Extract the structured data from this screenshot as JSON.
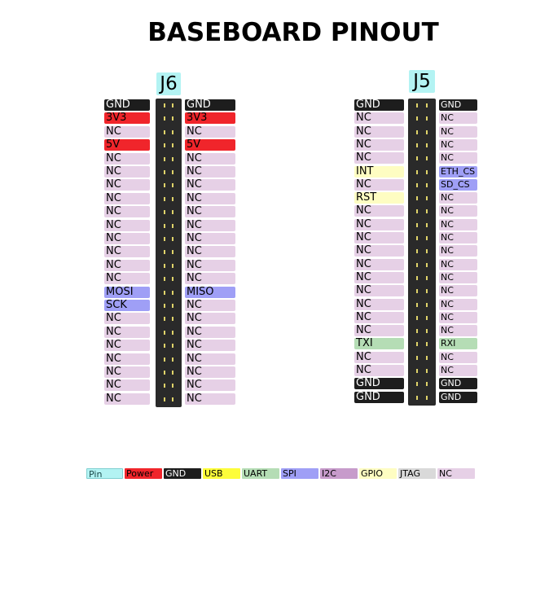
{
  "title": "BASEBOARD PINOUT",
  "colors": {
    "Pin": "#b3f3f3",
    "Power": "#f0252b",
    "GND": "#1d1d1d",
    "USB": "#fdfd3a",
    "UART": "#b5ddb5",
    "SPI": "#9f9ff6",
    "I2C": "#c79bcb",
    "GPIO": "#fefdc2",
    "JTAG": "#d9d9d9",
    "NC": "#e6d0e6"
  },
  "connectors": [
    {
      "name": "J6",
      "left": [
        {
          "label": "GND",
          "type": "GND"
        },
        {
          "label": "3V3",
          "type": "Power"
        },
        {
          "label": "NC",
          "type": "NC"
        },
        {
          "label": "5V",
          "type": "Power"
        },
        {
          "label": "NC",
          "type": "NC"
        },
        {
          "label": "NC",
          "type": "NC"
        },
        {
          "label": "NC",
          "type": "NC"
        },
        {
          "label": "NC",
          "type": "NC"
        },
        {
          "label": "NC",
          "type": "NC"
        },
        {
          "label": "NC",
          "type": "NC"
        },
        {
          "label": "NC",
          "type": "NC"
        },
        {
          "label": "NC",
          "type": "NC"
        },
        {
          "label": "NC",
          "type": "NC"
        },
        {
          "label": "NC",
          "type": "NC"
        },
        {
          "label": "MOSI",
          "type": "SPI"
        },
        {
          "label": "SCK",
          "type": "SPI"
        },
        {
          "label": "NC",
          "type": "NC"
        },
        {
          "label": "NC",
          "type": "NC"
        },
        {
          "label": "NC",
          "type": "NC"
        },
        {
          "label": "NC",
          "type": "NC"
        },
        {
          "label": "NC",
          "type": "NC"
        },
        {
          "label": "NC",
          "type": "NC"
        },
        {
          "label": "NC",
          "type": "NC"
        }
      ],
      "right": [
        {
          "label": "GND",
          "type": "GND"
        },
        {
          "label": "3V3",
          "type": "Power"
        },
        {
          "label": "NC",
          "type": "NC"
        },
        {
          "label": "5V",
          "type": "Power"
        },
        {
          "label": "NC",
          "type": "NC"
        },
        {
          "label": "NC",
          "type": "NC"
        },
        {
          "label": "NC",
          "type": "NC"
        },
        {
          "label": "NC",
          "type": "NC"
        },
        {
          "label": "NC",
          "type": "NC"
        },
        {
          "label": "NC",
          "type": "NC"
        },
        {
          "label": "NC",
          "type": "NC"
        },
        {
          "label": "NC",
          "type": "NC"
        },
        {
          "label": "NC",
          "type": "NC"
        },
        {
          "label": "NC",
          "type": "NC"
        },
        {
          "label": "MISO",
          "type": "SPI"
        },
        {
          "label": "NC",
          "type": "NC"
        },
        {
          "label": "NC",
          "type": "NC"
        },
        {
          "label": "NC",
          "type": "NC"
        },
        {
          "label": "NC",
          "type": "NC"
        },
        {
          "label": "NC",
          "type": "NC"
        },
        {
          "label": "NC",
          "type": "NC"
        },
        {
          "label": "NC",
          "type": "NC"
        },
        {
          "label": "NC",
          "type": "NC"
        }
      ]
    },
    {
      "name": "J5",
      "left": [
        {
          "label": "GND",
          "type": "GND"
        },
        {
          "label": "NC",
          "type": "NC"
        },
        {
          "label": "NC",
          "type": "NC"
        },
        {
          "label": "NC",
          "type": "NC"
        },
        {
          "label": "NC",
          "type": "NC"
        },
        {
          "label": "INT",
          "type": "GPIO"
        },
        {
          "label": "NC",
          "type": "NC"
        },
        {
          "label": "RST",
          "type": "GPIO"
        },
        {
          "label": "NC",
          "type": "NC"
        },
        {
          "label": "NC",
          "type": "NC"
        },
        {
          "label": "NC",
          "type": "NC"
        },
        {
          "label": "NC",
          "type": "NC"
        },
        {
          "label": "NC",
          "type": "NC"
        },
        {
          "label": "NC",
          "type": "NC"
        },
        {
          "label": "NC",
          "type": "NC"
        },
        {
          "label": "NC",
          "type": "NC"
        },
        {
          "label": "NC",
          "type": "NC"
        },
        {
          "label": "NC",
          "type": "NC"
        },
        {
          "label": "TXI",
          "type": "UART"
        },
        {
          "label": "NC",
          "type": "NC"
        },
        {
          "label": "NC",
          "type": "NC"
        },
        {
          "label": "GND",
          "type": "GND"
        },
        {
          "label": "GND",
          "type": "GND"
        }
      ],
      "right": [
        {
          "label": "GND",
          "type": "GND"
        },
        {
          "label": "NC",
          "type": "NC"
        },
        {
          "label": "NC",
          "type": "NC"
        },
        {
          "label": "NC",
          "type": "NC"
        },
        {
          "label": "NC",
          "type": "NC"
        },
        {
          "label": "ETH_CS",
          "type": "SPI"
        },
        {
          "label": "SD_CS",
          "type": "SPI"
        },
        {
          "label": "NC",
          "type": "NC"
        },
        {
          "label": "NC",
          "type": "NC"
        },
        {
          "label": "NC",
          "type": "NC"
        },
        {
          "label": "NC",
          "type": "NC"
        },
        {
          "label": "NC",
          "type": "NC"
        },
        {
          "label": "NC",
          "type": "NC"
        },
        {
          "label": "NC",
          "type": "NC"
        },
        {
          "label": "NC",
          "type": "NC"
        },
        {
          "label": "NC",
          "type": "NC"
        },
        {
          "label": "NC",
          "type": "NC"
        },
        {
          "label": "NC",
          "type": "NC"
        },
        {
          "label": "RXI",
          "type": "UART"
        },
        {
          "label": "NC",
          "type": "NC"
        },
        {
          "label": "NC",
          "type": "NC"
        },
        {
          "label": "GND",
          "type": "GND"
        },
        {
          "label": "GND",
          "type": "GND"
        }
      ]
    }
  ],
  "legend": [
    {
      "label": "Pin",
      "type": "Pin"
    },
    {
      "label": "Power",
      "type": "Power"
    },
    {
      "label": "GND",
      "type": "GND"
    },
    {
      "label": "USB",
      "type": "USB"
    },
    {
      "label": "UART",
      "type": "UART"
    },
    {
      "label": "SPI",
      "type": "SPI"
    },
    {
      "label": "I2C",
      "type": "I2C"
    },
    {
      "label": "GPIO",
      "type": "GPIO"
    },
    {
      "label": "JTAG",
      "type": "JTAG"
    },
    {
      "label": "NC",
      "type": "NC"
    }
  ]
}
